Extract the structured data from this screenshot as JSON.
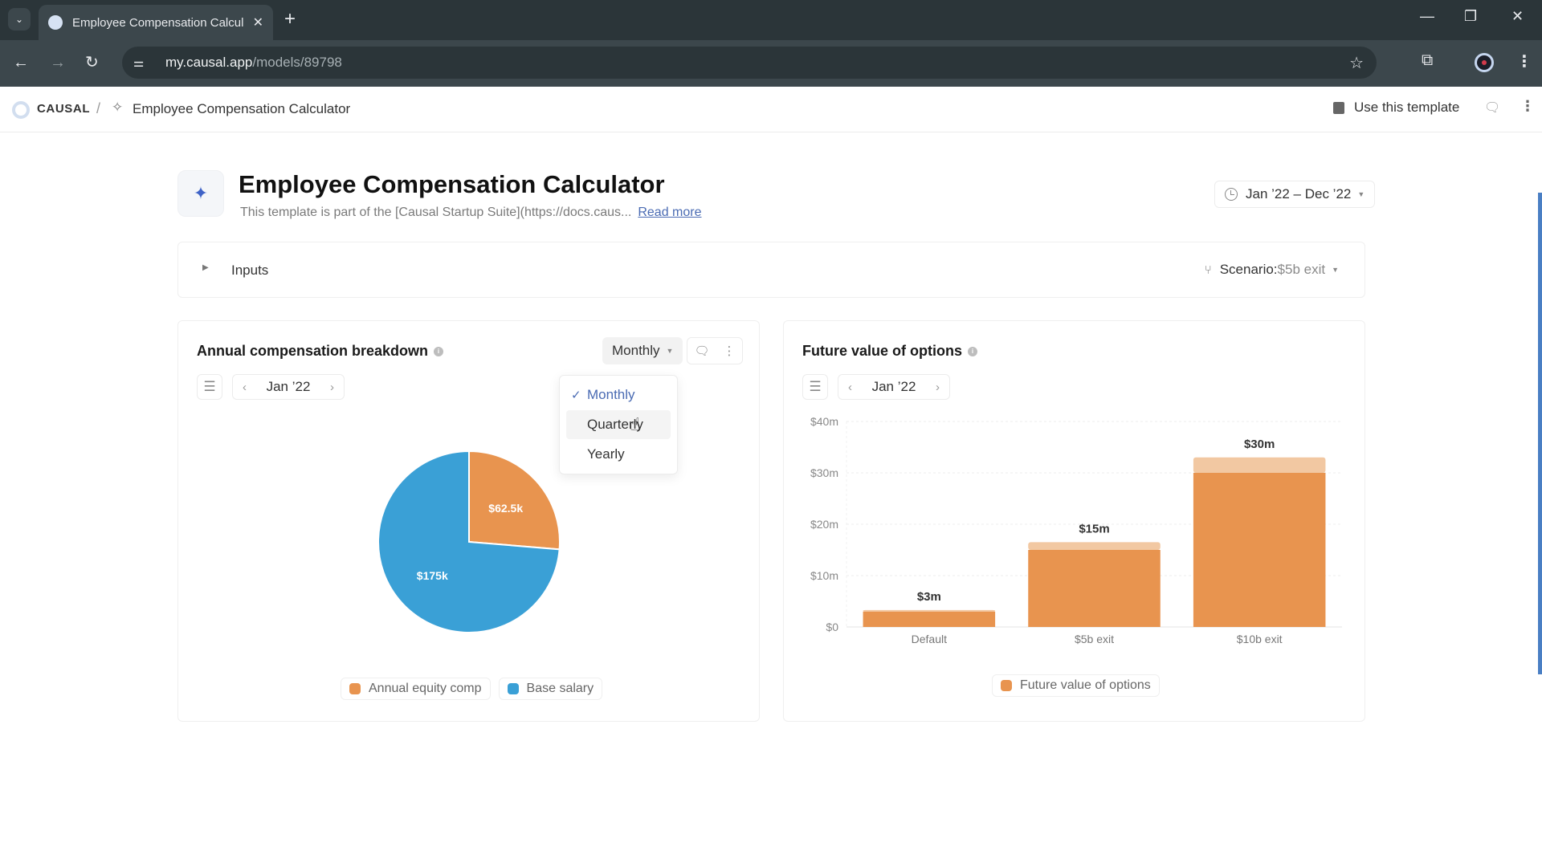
{
  "browser": {
    "tab_title": "Employee Compensation Calcul",
    "url_host": "my.causal.app",
    "url_path": "/models/89798",
    "icons": {
      "tab_search": "chevron-down-icon",
      "tab_close": "close-icon",
      "new_tab": "plus-icon",
      "back": "arrow-left-icon",
      "forward": "arrow-right-icon",
      "reload": "reload-icon",
      "site_info": "tune-icon",
      "bookmark": "star-icon",
      "extensions": "puzzle-icon",
      "menu": "kebab-icon"
    }
  },
  "appbar": {
    "brand": "CAUSAL",
    "separator": "/",
    "breadcrumb_title": "Employee Compensation Calculator",
    "use_template_label": "Use this template"
  },
  "page": {
    "title": "Employee Compensation Calculator",
    "description": "This template is part of the [Causal Startup Suite](https://docs.caus...",
    "read_more": "Read more",
    "date_range": "Jan ’22 – Dec ’22"
  },
  "inputs": {
    "label": "Inputs",
    "scenario_label": "Scenario:",
    "scenario_value": "$5b exit"
  },
  "left_card": {
    "title": "Annual compensation breakdown",
    "period": "Jan ’22",
    "granularity": "Monthly",
    "dropdown": {
      "options": [
        "Monthly",
        "Quarterly",
        "Yearly"
      ],
      "selected": "Monthly",
      "hovered": "Quarterly"
    }
  },
  "right_card": {
    "title": "Future value of options",
    "period": "Jan ’22"
  },
  "colors": {
    "orange": "#E8944F",
    "orange_light": "#F2C8A2",
    "blue": "#3AA0D6",
    "accent": "#4A6BB3"
  },
  "chart_data": [
    {
      "type": "pie",
      "title": "Annual compensation breakdown",
      "period": "Jan ’22",
      "slices": [
        {
          "label": "Annual equity comp",
          "value": 62.5,
          "display": "$62.5k",
          "color": "#E8944F"
        },
        {
          "label": "Base salary",
          "value": 175,
          "display": "$175k",
          "color": "#3AA0D6"
        }
      ],
      "units": "$k",
      "legend": "bottom"
    },
    {
      "type": "bar",
      "title": "Future value of options",
      "period": "Jan ’22",
      "categories": [
        "Default",
        "$5b exit",
        "$10b exit"
      ],
      "series": [
        {
          "name": "Future value of options",
          "values": [
            3,
            15,
            30
          ],
          "color": "#E8944F"
        }
      ],
      "highlight_tops": [
        3.3,
        16.5,
        33
      ],
      "data_labels": [
        "$3m",
        "$15m",
        "$30m"
      ],
      "yticks": [
        "$0",
        "$10m",
        "$20m",
        "$30m",
        "$40m"
      ],
      "ylim": [
        0,
        40
      ],
      "units": "$m",
      "grid": true,
      "legend": "bottom"
    }
  ]
}
